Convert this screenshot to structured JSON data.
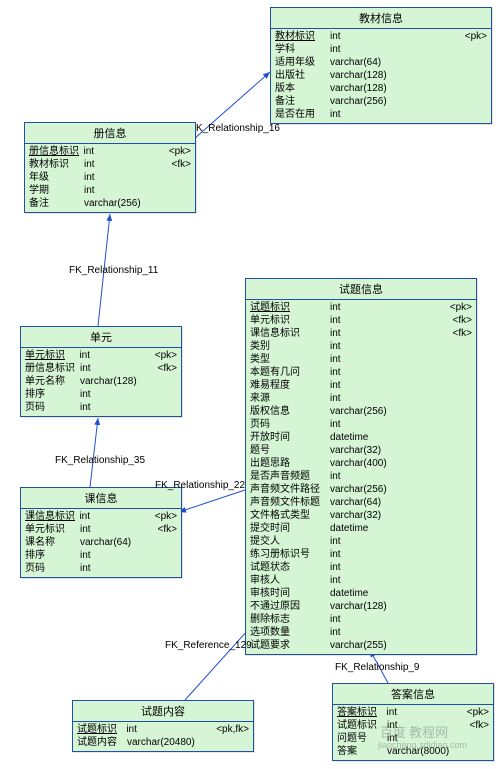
{
  "entities": {
    "teaching_material": {
      "title": "教材信息",
      "rows": [
        {
          "name": "教材标识",
          "type": "int",
          "key": "<pk>",
          "pk": true
        },
        {
          "name": "学科",
          "type": "int",
          "key": ""
        },
        {
          "name": "适用年级",
          "type": "varchar(64)",
          "key": ""
        },
        {
          "name": "出版社",
          "type": "varchar(128)",
          "key": ""
        },
        {
          "name": "版本",
          "type": "varchar(128)",
          "key": ""
        },
        {
          "name": "备注",
          "type": "varchar(256)",
          "key": ""
        },
        {
          "name": "是否在用",
          "type": "int",
          "key": ""
        }
      ]
    },
    "volume": {
      "title": "册信息",
      "rows": [
        {
          "name": "册信息标识",
          "type": "int",
          "key": "<pk>",
          "pk": true
        },
        {
          "name": "教材标识",
          "type": "int",
          "key": "<fk>"
        },
        {
          "name": "年级",
          "type": "int",
          "key": ""
        },
        {
          "name": "学期",
          "type": "int",
          "key": ""
        },
        {
          "name": "备注",
          "type": "varchar(256)",
          "key": ""
        }
      ]
    },
    "unit": {
      "title": "单元",
      "rows": [
        {
          "name": "单元标识",
          "type": "int",
          "key": "<pk>",
          "pk": true
        },
        {
          "name": "册信息标识",
          "type": "int",
          "key": "<fk>"
        },
        {
          "name": "单元名称",
          "type": "varchar(128)",
          "key": ""
        },
        {
          "name": "排序",
          "type": "int",
          "key": ""
        },
        {
          "name": "页码",
          "type": "int",
          "key": ""
        }
      ]
    },
    "lesson": {
      "title": "课信息",
      "rows": [
        {
          "name": "课信息标识",
          "type": "int",
          "key": "<pk>",
          "pk": true
        },
        {
          "name": "单元标识",
          "type": "int",
          "key": "<fk>"
        },
        {
          "name": "课名称",
          "type": "varchar(64)",
          "key": ""
        },
        {
          "name": "排序",
          "type": "int",
          "key": ""
        },
        {
          "name": "页码",
          "type": "int",
          "key": ""
        }
      ]
    },
    "question": {
      "title": "试题信息",
      "rows": [
        {
          "name": "试题标识",
          "type": "int",
          "key": "<pk>",
          "pk": true
        },
        {
          "name": "单元标识",
          "type": "int",
          "key": "<fk>"
        },
        {
          "name": "课信息标识",
          "type": "int",
          "key": "<fk>"
        },
        {
          "name": "类别",
          "type": "int",
          "key": ""
        },
        {
          "name": "类型",
          "type": "int",
          "key": ""
        },
        {
          "name": "本题有几问",
          "type": "int",
          "key": ""
        },
        {
          "name": "难易程度",
          "type": "int",
          "key": ""
        },
        {
          "name": "来源",
          "type": "int",
          "key": ""
        },
        {
          "name": "版权信息",
          "type": "varchar(256)",
          "key": ""
        },
        {
          "name": "页码",
          "type": "int",
          "key": ""
        },
        {
          "name": "开放时间",
          "type": "datetime",
          "key": ""
        },
        {
          "name": "题号",
          "type": "varchar(32)",
          "key": ""
        },
        {
          "name": "出题思路",
          "type": "varchar(400)",
          "key": ""
        },
        {
          "name": "是否声音频题",
          "type": "int",
          "key": ""
        },
        {
          "name": "声音频文件路径",
          "type": "varchar(256)",
          "key": ""
        },
        {
          "name": "声音频文件标题",
          "type": "varchar(64)",
          "key": ""
        },
        {
          "name": "文件格式类型",
          "type": "varchar(32)",
          "key": ""
        },
        {
          "name": "提交时间",
          "type": "datetime",
          "key": ""
        },
        {
          "name": "提交人",
          "type": "int",
          "key": ""
        },
        {
          "name": "练习册标识号",
          "type": "int",
          "key": ""
        },
        {
          "name": "试题状态",
          "type": "int",
          "key": ""
        },
        {
          "name": "审核人",
          "type": "int",
          "key": ""
        },
        {
          "name": "审核时间",
          "type": "datetime",
          "key": ""
        },
        {
          "name": "不通过原因",
          "type": "varchar(128)",
          "key": ""
        },
        {
          "name": "删除标志",
          "type": "int",
          "key": ""
        },
        {
          "name": "选项数量",
          "type": "int",
          "key": ""
        },
        {
          "name": "试题要求",
          "type": "varchar(255)",
          "key": ""
        }
      ]
    },
    "question_content": {
      "title": "试题内容",
      "rows": [
        {
          "name": "试题标识",
          "type": "int",
          "key": "<pk,fk>",
          "pk": true
        },
        {
          "name": "试题内容",
          "type": "varchar(20480)",
          "key": ""
        }
      ]
    },
    "answer": {
      "title": "答案信息",
      "rows": [
        {
          "name": "答案标识",
          "type": "int",
          "key": "<pk>",
          "pk": true
        },
        {
          "name": "试题标识",
          "type": "int",
          "key": "<fk>"
        },
        {
          "name": "问题号",
          "type": "int",
          "key": ""
        },
        {
          "name": "答案",
          "type": "varchar(8000)",
          "key": ""
        }
      ]
    }
  },
  "relationships": {
    "r16": "K_Relationship_16",
    "r11": "FK_Relationship_11",
    "r35": "FK_Relationship_35",
    "r22": "FK_Relationship_22",
    "r129": "FK_Reference_129",
    "r9": "FK_Relationship_9"
  },
  "watermark": {
    "a": "百度",
    "b": "教程网",
    "c": "jiaocheng.zdidian.com"
  }
}
